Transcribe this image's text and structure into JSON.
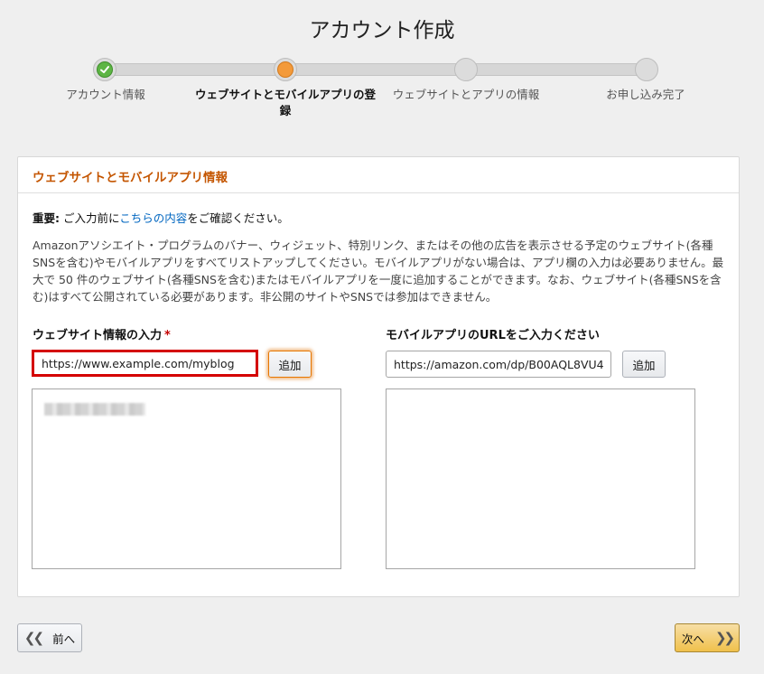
{
  "page": {
    "title": "アカウント作成"
  },
  "stepper": {
    "steps": [
      {
        "label": "アカウント情報",
        "state": "done"
      },
      {
        "label": "ウェブサイトとモバイルアプリの登録",
        "state": "current"
      },
      {
        "label": "ウェブサイトとアプリの情報",
        "state": "pending"
      },
      {
        "label": "お申し込み完了",
        "state": "pending"
      }
    ]
  },
  "panel": {
    "header": "ウェブサイトとモバイルアプリ情報",
    "important_prefix": "重要:",
    "important_text_before": " ご入力前に",
    "important_link": "こちらの内容",
    "important_text_after": "をご確認ください。",
    "description": "Amazonアソシエイト・プログラムのバナー、ウィジェット、特別リンク、またはその他の広告を表示させる予定のウェブサイト(各種SNSを含む)やモバイルアプリをすべてリストアップしてください。モバイルアプリがない場合は、アプリ欄の入力は必要ありません。最大で 50 件のウェブサイト(各種SNSを含む)またはモバイルアプリを一度に追加することができます。なお、ウェブサイト(各種SNSを含む)はすべて公開されている必要があります。非公開のサイトやSNSでは参加はできません。",
    "website": {
      "label": "ウェブサイト情報の入力",
      "required_mark": "*",
      "value": "https://www.example.com/myblog",
      "add_label": "追加"
    },
    "mobile": {
      "label": "モバイルアプリのURLをご入力ください",
      "value": "https://amazon.com/dp/B00AQL8VU4",
      "add_label": "追加"
    }
  },
  "nav": {
    "prev_label": "前へ",
    "next_label": "次へ"
  },
  "colors": {
    "accent": "#c45500",
    "link": "#0066c0",
    "done": "#5db544",
    "current": "#f39a3a",
    "highlight": "#d40000"
  }
}
